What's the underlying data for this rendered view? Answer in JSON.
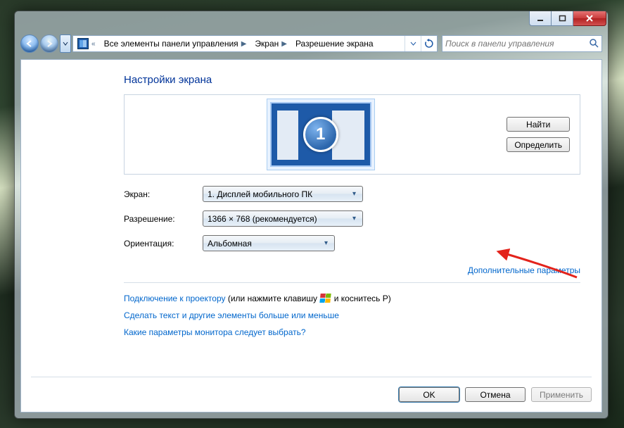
{
  "titlebar": {
    "min_tip": "Свернуть",
    "max_tip": "Развернуть",
    "close_tip": "Закрыть"
  },
  "nav": {
    "back_tip": "Назад",
    "fwd_tip": "Вперёд",
    "history_tip": "Последние страницы",
    "refresh_tip": "Обновить"
  },
  "breadcrumb": {
    "root_overflow": "«",
    "items": [
      "Все элементы панели управления",
      "Экран",
      "Разрешение экрана"
    ]
  },
  "search": {
    "placeholder": "Поиск в панели управления"
  },
  "heading": "Настройки экрана",
  "monitor_id": "1",
  "side_buttons": {
    "detect": "Найти",
    "identify": "Определить"
  },
  "fields": {
    "display_label": "Экран:",
    "display_value": "1. Дисплей мобильного ПК",
    "resolution_label": "Разрешение:",
    "resolution_value": "1366 × 768 (рекомендуется)",
    "orientation_label": "Ориентация:",
    "orientation_value": "Альбомная"
  },
  "advanced_link": "Дополнительные параметры",
  "links": {
    "projector_a": "Подключение к проектору",
    "projector_mid": "(или нажмите клавишу",
    "projector_b": "и коснитесь P)",
    "text_size": "Сделать текст и другие элементы больше или меньше",
    "which_monitor": "Какие параметры монитора следует выбрать?"
  },
  "footer": {
    "ok": "OK",
    "cancel": "Отмена",
    "apply": "Применить"
  }
}
